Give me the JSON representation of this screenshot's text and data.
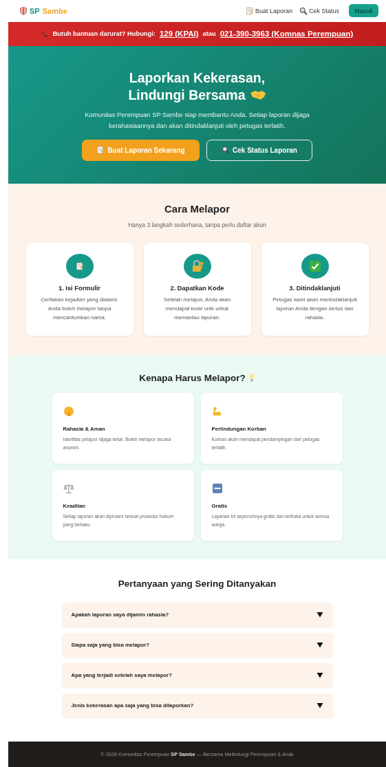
{
  "header": {
    "logo_primary": "SP",
    "logo_secondary": "Sambe",
    "nav": [
      {
        "label": "Buat Laporan"
      },
      {
        "label": "Cek Status"
      }
    ],
    "login_button": "Masuk"
  },
  "emergency_banner": {
    "text": "Butuh bantuan darurat? Hubungi:",
    "links": [
      "129 (KPAI)",
      "021-390-3963 (Komnas Perempuan)"
    ],
    "separator": "atau"
  },
  "hero": {
    "title_line_1": "Laporkan Kekerasan,",
    "title_line_2": "Lindungi Bersama",
    "description": "Komunitas Perempuan SP Sambe siap membantu Anda. Setiap laporan dijaga kerahasiaannya dan akan ditindaklanjuti oleh petugas terlatih.",
    "buttons": [
      {
        "label": "Buat Laporan Sekarang",
        "kind": "primary"
      },
      {
        "label": "Cek Status Laporan",
        "kind": "outline"
      }
    ]
  },
  "steps": {
    "title": "Cara Melapor",
    "subtitle": "Hanya 3 langkah sederhana, tanpa perlu daftar akun",
    "items": [
      {
        "title": "1. Isi Formulir",
        "text": "Ceritakan kejadian yang dialami. Anda boleh melapor tanpa mencantumkan nama."
      },
      {
        "title": "2. Dapatkan Kode",
        "text": "Setelah melapor, Anda akan mendapat kode unik untuk memantau laporan."
      },
      {
        "title": "3. Ditindaklanjuti",
        "text": "Petugas kami akan menindaklanjuti laporan Anda dengan serius dan rahasia."
      }
    ]
  },
  "reasons": {
    "title": "Kenapa Harus Melapor?",
    "items": [
      {
        "title": "Rahasia & Aman",
        "text": "Identitas pelapor dijaga ketat. Boleh melapor secara anonim."
      },
      {
        "title": "Perlindungan Korban",
        "text": "Korban akan mendapat pendampingan dari petugas terlatih."
      },
      {
        "title": "Keadilan",
        "text": "Setiap laporan akan diproses sesuai prosedur hukum yang berlaku."
      },
      {
        "title": "Gratis",
        "text": "Layanan ini sepenuhnya gratis dan terbuka untuk semua warga."
      }
    ]
  },
  "faq": {
    "title": "Pertanyaan yang Sering Ditanyakan",
    "items": [
      {
        "question": "Apakah laporan saya dijamin rahasia?",
        "expanded": false
      },
      {
        "question": "Siapa saja yang bisa melapor?",
        "expanded": false
      },
      {
        "question": "Apa yang terjadi setelah saya melapor?",
        "expanded": false
      },
      {
        "question": "Jenis kekerasan apa saja yang bisa dilaporkan?",
        "expanded": false
      }
    ]
  },
  "footer": {
    "text": "© 2026 Komunitas Perempuan **SP Sambe** — Bersama Melindungi Perempuan & Anak"
  }
}
